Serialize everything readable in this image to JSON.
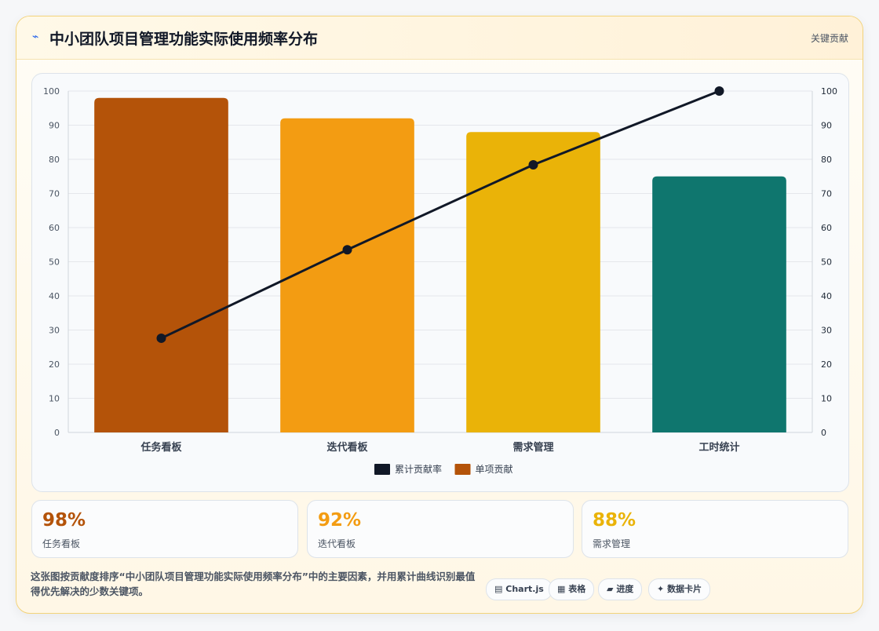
{
  "header": {
    "icon": "⌁",
    "title": "中小团队项目管理功能实际使用频率分布",
    "right_label": "关键贡献"
  },
  "chart_data": {
    "type": "bar",
    "categories": [
      "任务看板",
      "迭代看板",
      "需求管理",
      "工时统计"
    ],
    "series": [
      {
        "name": "单项贡献",
        "type": "bar",
        "values": [
          98,
          92,
          88,
          75
        ],
        "colors": [
          "#b45309",
          "#f39c12",
          "#eab308",
          "#0f766e"
        ]
      },
      {
        "name": "累计贡献率",
        "type": "line",
        "values": [
          27.6,
          53.5,
          78.4,
          100
        ],
        "color": "#111827"
      }
    ],
    "ylim": [
      0,
      100
    ],
    "y_ticks": [
      0,
      10,
      20,
      30,
      40,
      50,
      60,
      70,
      80,
      90,
      100
    ],
    "y2lim": [
      0,
      100
    ],
    "y2_ticks": [
      0,
      10,
      20,
      30,
      40,
      50,
      60,
      70,
      80,
      90,
      100
    ],
    "grid": true,
    "legend": [
      {
        "label": "累计贡献率",
        "color": "#111827"
      },
      {
        "label": "单项贡献",
        "color": "#b45309"
      }
    ],
    "legend_position": "bottom"
  },
  "stats": [
    {
      "value": "98%",
      "label": "任务看板",
      "color": "#b45309"
    },
    {
      "value": "92%",
      "label": "迭代看板",
      "color": "#f39c12"
    },
    {
      "value": "88%",
      "label": "需求管理",
      "color": "#eab308"
    }
  ],
  "description": "这张图按贡献度排序“中小团队项目管理功能实际使用频率分布”中的主要因素，并用累计曲线识别最值得优先解决的少数关键项。",
  "badges": [
    {
      "label": "Chart.js",
      "icon": "▤"
    },
    {
      "label": "表格",
      "icon": "▦"
    },
    {
      "label": "进度",
      "icon": "▰"
    },
    {
      "label": "数据卡片",
      "icon": "✦"
    }
  ]
}
